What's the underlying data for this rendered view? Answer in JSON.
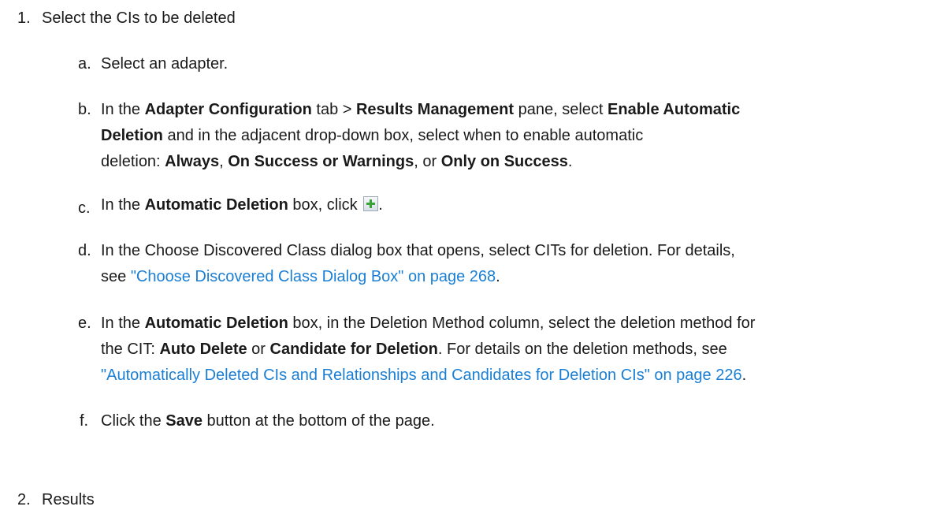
{
  "steps": [
    {
      "num": "1.",
      "title": "Select the CIs to be deleted",
      "substeps": {
        "a": {
          "marker": "a.",
          "text": "Select an adapter."
        },
        "b": {
          "marker": "b.",
          "t1": "In the ",
          "b1": "Adapter Configuration",
          "t2": " tab > ",
          "b2": "Results Management",
          "t3": " pane, select ",
          "b3": "Enable Automatic",
          "b4": "Deletion",
          "t4": " and in the adjacent drop-down box, select when to enable automatic",
          "t5": "deletion: ",
          "b5": "Always",
          "t6": ", ",
          "b6": "On Success or Warnings",
          "t7": ", or ",
          "b7": "Only on Success",
          "t8": "."
        },
        "c": {
          "marker": "c.",
          "t1": "In the ",
          "b1": "Automatic Deletion",
          "t2": " box, click ",
          "t3": ".",
          "icon": "add-icon"
        },
        "d": {
          "marker": "d.",
          "t1": "In the Choose Discovered Class dialog box that opens, select CITs for deletion. For details,",
          "t2": "see ",
          "link": "\"Choose Discovered Class Dialog Box\" on page 268",
          "t3": "."
        },
        "e": {
          "marker": "e.",
          "t1": "In the ",
          "b1": "Automatic Deletion",
          "t2": " box, in the Deletion Method column, select the deletion method for",
          "t3": "the CIT: ",
          "b2": "Auto Delete",
          "t4": " or ",
          "b3": "Candidate for Deletion",
          "t5": ". For details on the deletion methods, see",
          "link": "\"Automatically Deleted CIs and Relationships and Candidates for Deletion CIs\" on page 226",
          "t6": "."
        },
        "f": {
          "marker": "f.",
          "t1": "Click the ",
          "b1": "Save",
          "t2": " button at the bottom of the page."
        }
      }
    },
    {
      "num": "2.",
      "title": "Results"
    }
  ],
  "colors": {
    "text": "#1a1a1a",
    "link": "#1a7fd4",
    "add_icon": "#3aa335"
  }
}
